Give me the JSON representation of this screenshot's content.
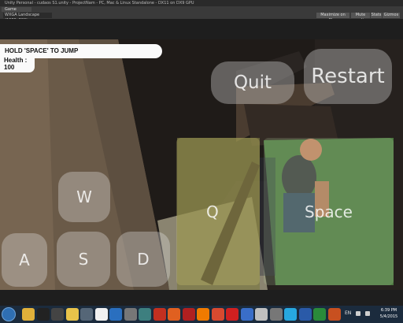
{
  "titlebar": {
    "text": "Unity Personal - cudaos S1.unity - ProjectNam - PC, Mac & Linux Standalone - DX11 on DX9 GPU"
  },
  "game_tab": {
    "label": "Game"
  },
  "aspect": {
    "label": "WXGA Landscape (1280x800)"
  },
  "toolbar": {
    "maximize": "Maximize on Play",
    "mute": "Mute audio",
    "stats": "Stats",
    "gizmos": "Gizmos"
  },
  "hud": {
    "instruction": "HOLD 'SPACE' TO JUMP",
    "health_label": "Health :",
    "health_value": "100"
  },
  "controls": {
    "quit": "Quit",
    "restart": "Restart",
    "w": "W",
    "a": "A",
    "s": "S",
    "d": "D",
    "q": "Q",
    "space": "Space"
  },
  "taskbar": {
    "tray_lang": "EN",
    "time": "6:39 PM",
    "date": "5/4/2015",
    "icons": [
      "chrome-icon",
      "unity-icon",
      "unity-icon",
      "explorer-icon",
      "monodevelop-icon",
      "inkscape-icon",
      "photoshop-icon",
      "zbrush-icon",
      "maya-icon",
      "pdf-icon",
      "media-player-icon",
      "filezilla-icon",
      "vlc-icon",
      "firefox-icon",
      "opera-icon",
      "blender-icon",
      "itunes-icon",
      "gimp-icon",
      "skype-icon",
      "word-icon",
      "excel-icon",
      "powerpoint-icon"
    ],
    "icon_colors": [
      "#e0b03a",
      "#222222",
      "#444444",
      "#e8c34a",
      "#556677",
      "#f0f0f0",
      "#2a6fbf",
      "#777777",
      "#3d7f7f",
      "#c23020",
      "#e06020",
      "#b02020",
      "#f07a00",
      "#d84a30",
      "#d02020",
      "#3a6ec8",
      "#c0c0c0",
      "#777777",
      "#27a8e0",
      "#2a5aa8",
      "#2a8a3a",
      "#c85020"
    ]
  }
}
